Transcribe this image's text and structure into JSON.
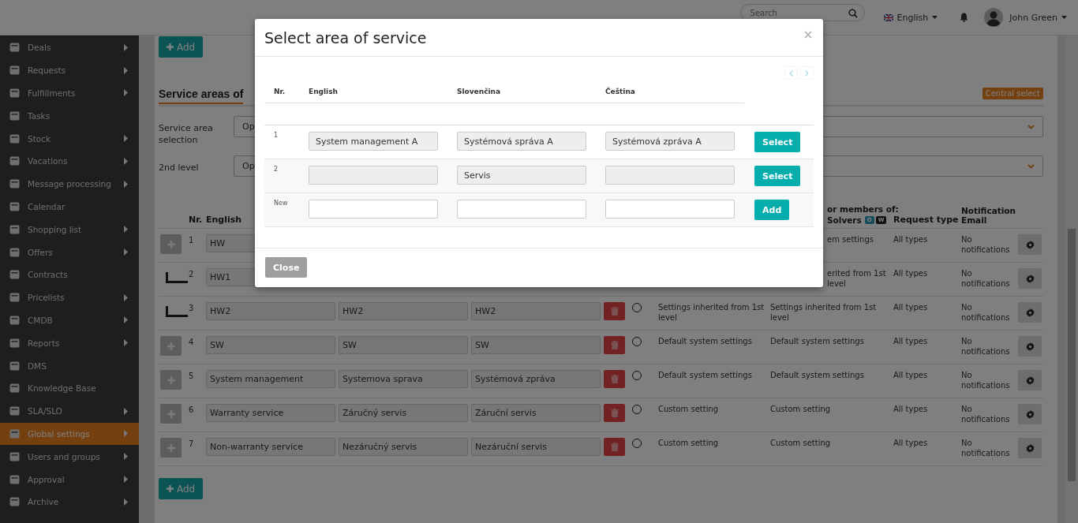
{
  "topbar": {
    "search": {
      "placeholder": "Search"
    },
    "language": "English",
    "user": "John Green"
  },
  "sidebar": {
    "items": [
      {
        "label": "Deals",
        "submenu": true,
        "selected": false
      },
      {
        "label": "Requests",
        "submenu": true,
        "selected": false
      },
      {
        "label": "Fulfillments",
        "submenu": true,
        "selected": false
      },
      {
        "label": "Tasks",
        "submenu": false,
        "selected": false
      },
      {
        "label": "Stock",
        "submenu": true,
        "selected": false
      },
      {
        "label": "Vacations",
        "submenu": true,
        "selected": false
      },
      {
        "label": "Message processing",
        "submenu": true,
        "selected": false
      },
      {
        "label": "Calendar",
        "submenu": false,
        "selected": false
      },
      {
        "label": "Shopping list",
        "submenu": true,
        "selected": false
      },
      {
        "label": "Offers",
        "submenu": true,
        "selected": false
      },
      {
        "label": "Contracts",
        "submenu": false,
        "selected": false
      },
      {
        "label": "Pricelists",
        "submenu": true,
        "selected": false
      },
      {
        "label": "CMDB",
        "submenu": true,
        "selected": false
      },
      {
        "label": "Reports",
        "submenu": true,
        "selected": false
      },
      {
        "label": "DMS",
        "submenu": false,
        "selected": false
      },
      {
        "label": "Knowledge Base",
        "submenu": false,
        "selected": false
      },
      {
        "label": "SLA/SLO",
        "submenu": true,
        "selected": false
      },
      {
        "label": "Global settings",
        "submenu": true,
        "selected": true
      },
      {
        "label": "Users and groups",
        "submenu": true,
        "selected": false
      },
      {
        "label": "Approval",
        "submenu": true,
        "selected": false
      },
      {
        "label": "Archive",
        "submenu": true,
        "selected": false
      }
    ]
  },
  "page": {
    "add_top": "Add",
    "add_bottom": "Add",
    "section_title": "Service areas of",
    "central_select": "Central select",
    "filters": [
      {
        "label": "Service area selection",
        "value": "Op"
      },
      {
        "label": "2nd level",
        "value": "Op"
      }
    ],
    "table": {
      "header": {
        "nr": "Nr.",
        "english": "English",
        "solvers_line1": "or members of:",
        "solvers_line2": "Solvers",
        "badges": [
          "O",
          "W"
        ],
        "request_type": "Request type",
        "notification": "Notification Email"
      },
      "rows": [
        {
          "nr": "1",
          "kind": "root",
          "english": "HW",
          "solvers": "em settings",
          "request_type": "All types",
          "notification": "No notifications"
        },
        {
          "nr": "2",
          "kind": "child",
          "english": "HW1",
          "solvers": "erited from 1st level",
          "request_type": "All types",
          "notification": "No notifications"
        },
        {
          "nr": "3",
          "kind": "child",
          "english": "HW2",
          "slovak": "HW2",
          "czech": "HW2",
          "selected": false,
          "inherit": "Settings inherited from 1st level",
          "solvers": "Settings inherited from 1st level",
          "request_type": "All types",
          "notification": "No notifications"
        },
        {
          "nr": "4",
          "kind": "root",
          "english": "SW",
          "slovak": "SW",
          "czech": "SW",
          "selected": false,
          "inherit": "Default system settings",
          "solvers": "Default system settings",
          "request_type": "All types",
          "notification": "No notifications"
        },
        {
          "nr": "5",
          "kind": "root",
          "english": "System management",
          "slovak": "Systemova sprava",
          "czech": "Systémová zpráva",
          "selected": false,
          "inherit": "Default system settings",
          "solvers": "Default system settings",
          "request_type": "All types",
          "notification": "No notifications"
        },
        {
          "nr": "6",
          "kind": "root",
          "english": "Warranty service",
          "slovak": "Záručný servis",
          "czech": "Záruční servis",
          "selected": false,
          "inherit": "Custom setting",
          "solvers": "Custom setting",
          "request_type": "All types",
          "notification": "No notifications"
        },
        {
          "nr": "7",
          "kind": "root",
          "english": "Non-warranty service",
          "slovak": "Nezáručný servis",
          "czech": "Nezáruční servis",
          "selected": false,
          "inherit": "Custom setting",
          "solvers": "Custom setting",
          "request_type": "All types",
          "notification": "No notifications"
        }
      ]
    }
  },
  "modal": {
    "title": "Select area of service",
    "pager": {
      "disabled": true
    },
    "columns": [
      "Nr.",
      "English",
      "Slovenčina",
      "Čeština"
    ],
    "rows": [
      {
        "nr": "1",
        "english": "System management A",
        "slovak": "Systémová správa A",
        "czech": "Systémová zpráva A",
        "action": "Select"
      },
      {
        "nr": "2",
        "slovak": "Servis",
        "action": "Select"
      }
    ],
    "new_row": {
      "label": "New",
      "action": "Add"
    },
    "close": {
      "label": "Close",
      "disabled": true
    }
  }
}
